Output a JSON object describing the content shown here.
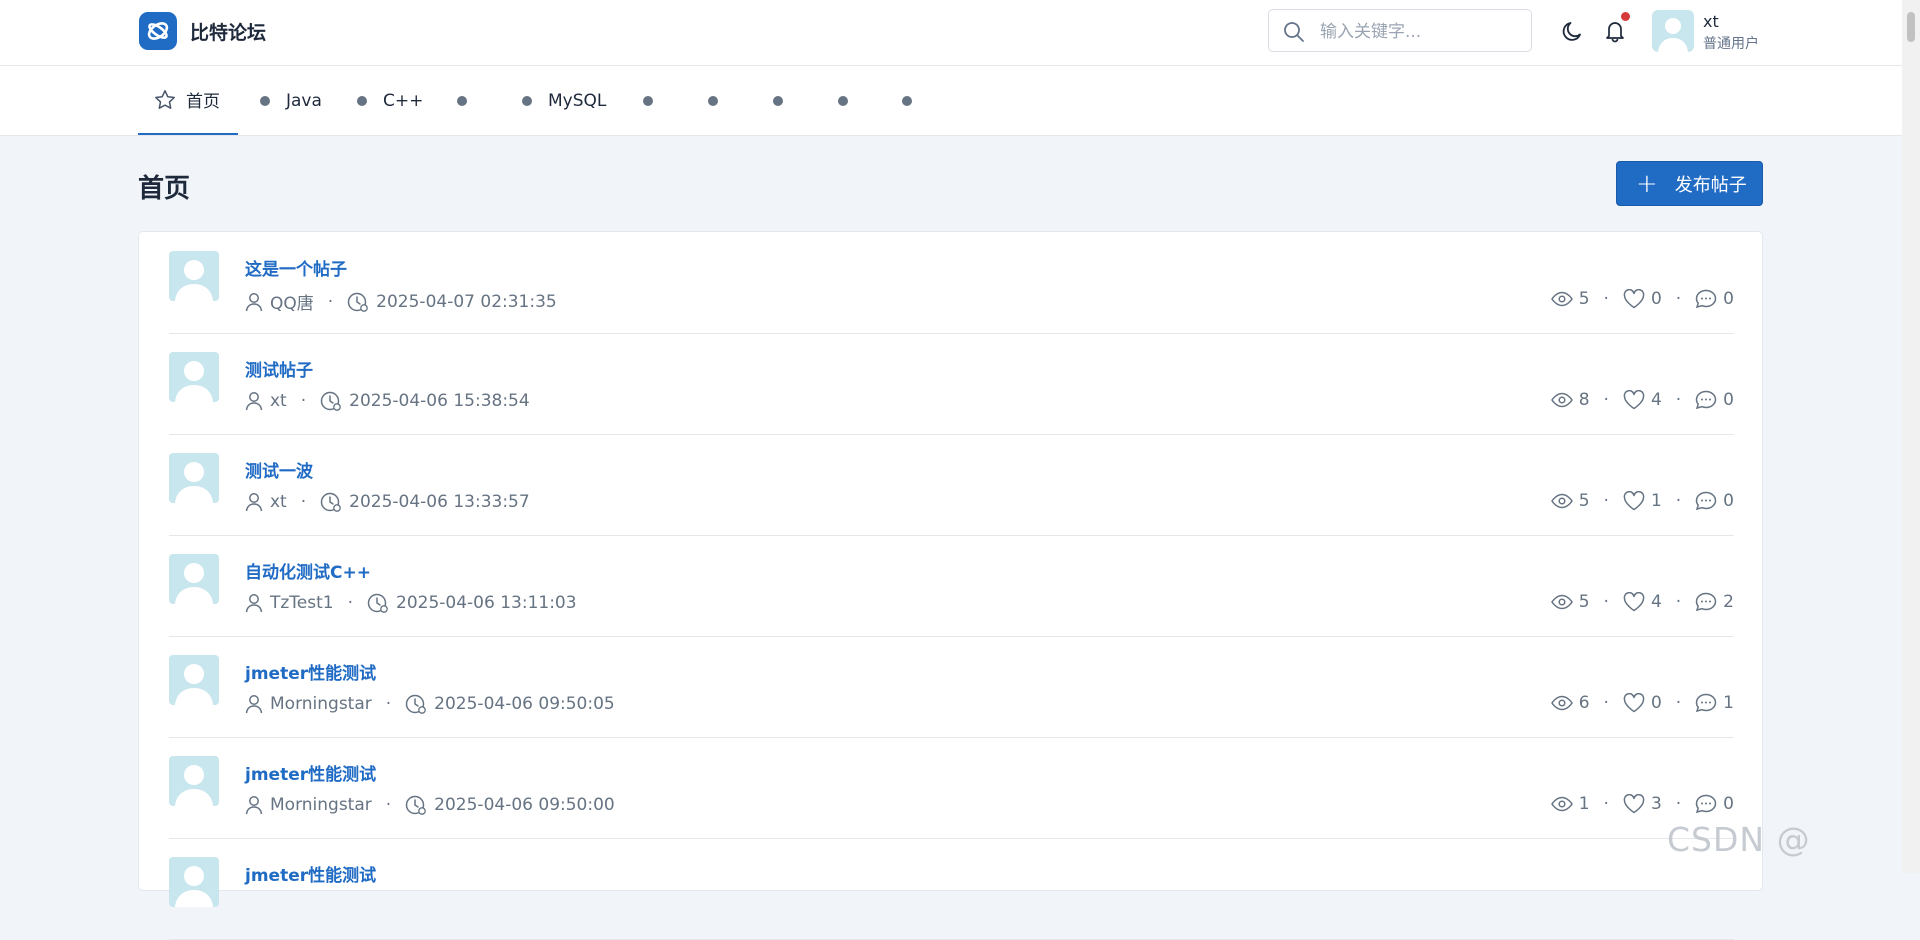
{
  "header": {
    "brand": "比特论坛",
    "search_placeholder": "输入关键字...",
    "user": {
      "name": "xt",
      "role": "普通用户"
    }
  },
  "nav": {
    "home": "首页",
    "items": [
      "Java",
      "C++",
      "",
      "MySQL",
      "",
      "",
      "",
      "",
      ""
    ]
  },
  "page": {
    "title": "首页",
    "new_post_label": "发布帖子"
  },
  "posts": [
    {
      "title": "这是一个帖子",
      "author": "QQ唐",
      "time": "2025-04-07 02:31:35",
      "views": "5",
      "likes": "0",
      "comments": "0"
    },
    {
      "title": "测试帖子",
      "author": "xt",
      "time": "2025-04-06 15:38:54",
      "views": "8",
      "likes": "4",
      "comments": "0"
    },
    {
      "title": "测试一波",
      "author": "xt",
      "time": "2025-04-06 13:33:57",
      "views": "5",
      "likes": "1",
      "comments": "0"
    },
    {
      "title": "自动化测试C++",
      "author": "TzTest1",
      "time": "2025-04-06 13:11:03",
      "views": "5",
      "likes": "4",
      "comments": "2"
    },
    {
      "title": "jmeter性能测试",
      "author": "Morningstar",
      "time": "2025-04-06 09:50:05",
      "views": "6",
      "likes": "0",
      "comments": "1"
    },
    {
      "title": "jmeter性能测试",
      "author": "Morningstar",
      "time": "2025-04-06 09:50:00",
      "views": "1",
      "likes": "3",
      "comments": "0"
    },
    {
      "title": "jmeter性能测试",
      "author": "",
      "time": "",
      "views": "",
      "likes": "",
      "comments": ""
    }
  ],
  "watermark": "CSDN @",
  "colors": {
    "accent": "#206bc4",
    "muted": "#667382",
    "notification": "#d63939"
  }
}
